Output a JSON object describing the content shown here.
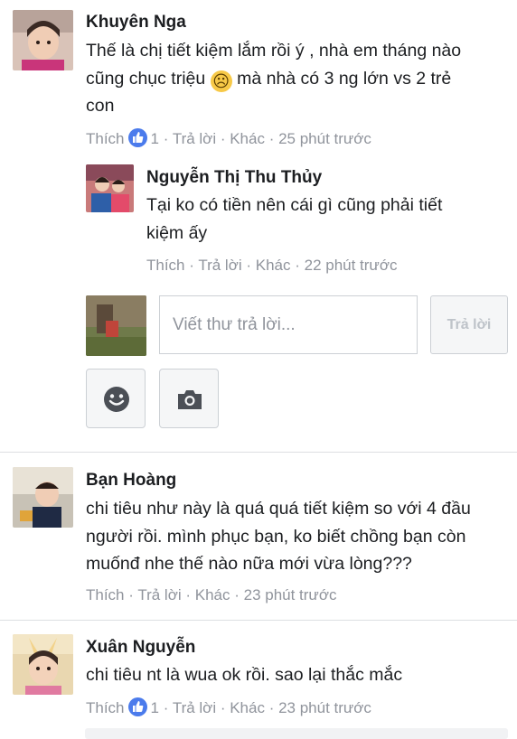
{
  "comments": [
    {
      "name": "Khuyên Nga",
      "lines": [
        "Thế là chị tiết kiệm lắm rồi ý , nhà em tháng nào",
        "cũng chục triệu",
        "mà nhà có 3 ng lớn vs 2 trẻ",
        "con"
      ],
      "like_label": "Thích",
      "like_count": "1",
      "reply_label": "Trả lời",
      "more_label": "Khác",
      "time": "25 phút trước",
      "emoji": "☹"
    },
    {
      "name": "Nguyễn Thị Thu Thủy",
      "lines": [
        "Tại ko có tiền nên cái gì cũng phải tiết",
        "kiệm ấy"
      ],
      "like_label": "Thích",
      "reply_label": "Trả lời",
      "more_label": "Khác",
      "time": "22 phút trước"
    },
    {
      "name": "Bạn Hoàng",
      "lines": [
        "chi tiêu như này là quá quá tiết kiệm so với 4 đầu",
        "người rồi. mình phục bạn, ko biết chồng bạn còn",
        "muốnđ nhe thế nào nữa mới vừa lòng???"
      ],
      "like_label": "Thích",
      "reply_label": "Trả lời",
      "more_label": "Khác",
      "time": "23 phút trước"
    },
    {
      "name": "Xuân Nguyễn",
      "lines": [
        "chi tiêu nt là wua ok rồi. sao lại thắc mắc"
      ],
      "like_label": "Thích",
      "like_count": "1",
      "reply_label": "Trả lời",
      "more_label": "Khác",
      "time": "23 phút trước"
    }
  ],
  "reply_box": {
    "placeholder": "Viết thư trả lời...",
    "button_label": "Trả lời"
  },
  "icons": {
    "like": "thumbs-up-icon",
    "emoji": "smiley-icon",
    "camera": "camera-icon"
  },
  "colors": {
    "meta": "#90949c",
    "like_badge": "#4b7bec",
    "separator": "#dddfe2"
  }
}
